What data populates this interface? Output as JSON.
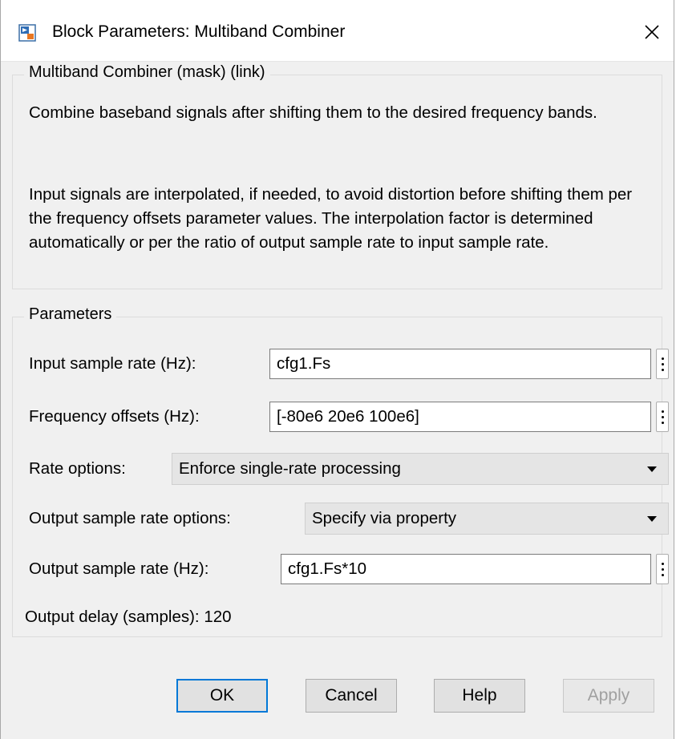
{
  "window": {
    "title": "Block Parameters: Multiband Combiner",
    "icon": "simulink-block-icon",
    "close_icon": "close-icon"
  },
  "mask_group": {
    "legend": "Multiband Combiner (mask) (link)",
    "description_1": "Combine baseband signals after shifting them to the desired frequency bands.",
    "description_2": "Input signals are interpolated, if needed, to avoid distortion before shifting them per the frequency offsets parameter values. The interpolation factor is determined automatically or per the ratio of output sample rate to input sample rate."
  },
  "parameters": {
    "legend": "Parameters",
    "input_sample_rate": {
      "label": "Input sample rate (Hz):",
      "value": "cfg1.Fs"
    },
    "frequency_offsets": {
      "label": "Frequency offsets (Hz):",
      "value": "[-80e6 20e6 100e6]"
    },
    "rate_options": {
      "label": "Rate options:",
      "value": "Enforce single-rate processing"
    },
    "output_rate_options": {
      "label": "Output sample rate options:",
      "value": "Specify via property"
    },
    "output_sample_rate": {
      "label": "Output sample rate (Hz):",
      "value": "cfg1.Fs*10"
    },
    "output_delay": "Output delay (samples): 120"
  },
  "buttons": {
    "ok": "OK",
    "cancel": "Cancel",
    "help": "Help",
    "apply": "Apply"
  },
  "colors": {
    "dialog_bg": "#f0f0f0",
    "default_button_border": "#0078d7",
    "disabled_text": "#a0a0a0"
  }
}
